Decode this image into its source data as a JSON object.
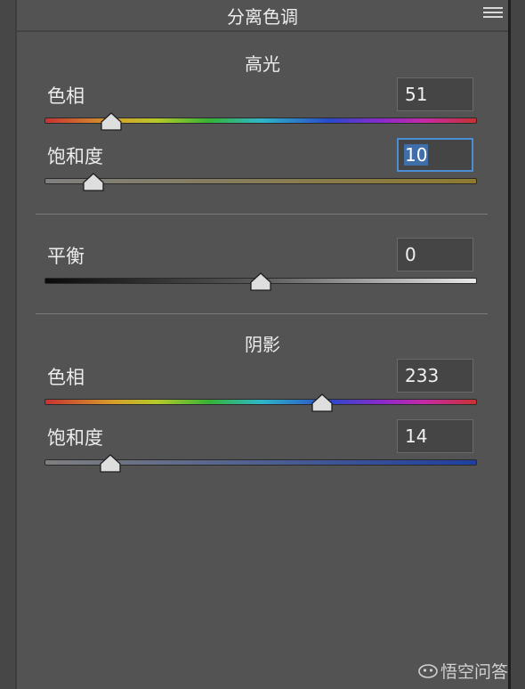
{
  "panel": {
    "title": "分离色调"
  },
  "highlights": {
    "section_title": "高光",
    "hue": {
      "label": "色相",
      "value": "51",
      "value_max": 360
    },
    "saturation": {
      "label": "饱和度",
      "value": "10",
      "value_max": 100
    }
  },
  "balance": {
    "label": "平衡",
    "value": "0",
    "min": -100,
    "max": 100
  },
  "shadows": {
    "section_title": "阴影",
    "hue": {
      "label": "色相",
      "value": "233",
      "value_max": 360
    },
    "saturation": {
      "label": "饱和度",
      "value": "14",
      "value_max": 100
    }
  },
  "watermark": {
    "text": "悟空问答"
  },
  "colors": {
    "panel_bg": "#535353",
    "focus_border": "#4a8fd6",
    "highlight_sat_tint": "#8e7a2e",
    "shadow_sat_tint": "#1f3fa0"
  }
}
